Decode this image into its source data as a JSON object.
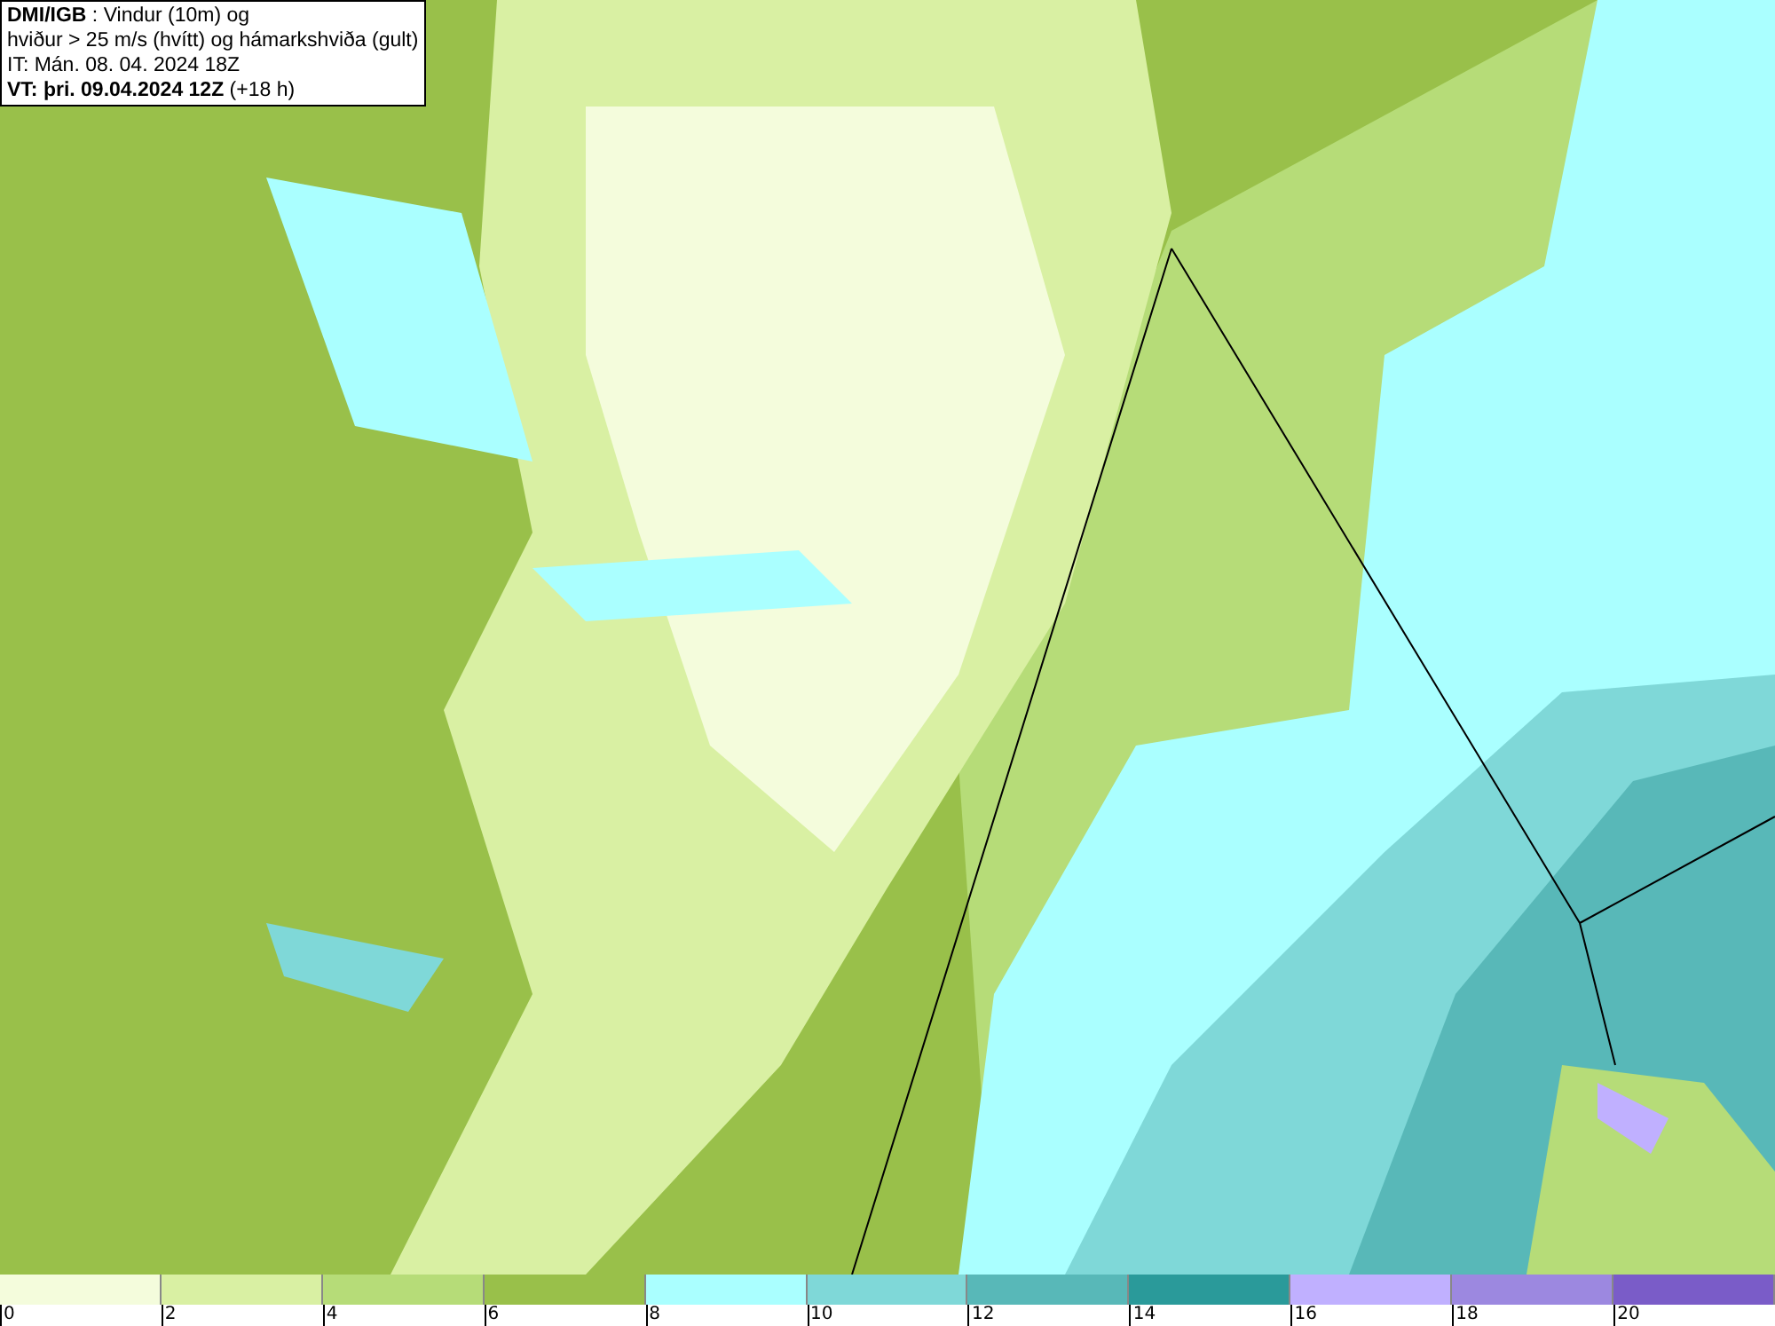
{
  "legend": {
    "lines": [
      "**DMI/IGB** : Vindur (10m) og",
      "hviður > 25 m/s (hvítt) og hámarkshviða (gult)",
      "IT: Mán. 08. 04. 2024 18Z",
      "**VT: þri. 09.04.2024 12Z** (+18 h)"
    ]
  },
  "colorbar": {
    "segments": [
      {
        "color": "#f4fcdc"
      },
      {
        "color": "#d9f0a3"
      },
      {
        "color": "#b6dc78"
      },
      {
        "color": "#99c04a"
      },
      {
        "color": "#aaffff"
      },
      {
        "color": "#7fd8d8"
      },
      {
        "color": "#58b8b8"
      },
      {
        "color": "#2a9a9a"
      },
      {
        "color": "#c0b0ff"
      },
      {
        "color": "#9c88e0"
      },
      {
        "color": "#7a5cc8"
      }
    ],
    "ticks": [
      "0",
      "2",
      "4",
      "6",
      "8",
      "10",
      "12",
      "14",
      "16",
      "18",
      "20"
    ]
  }
}
